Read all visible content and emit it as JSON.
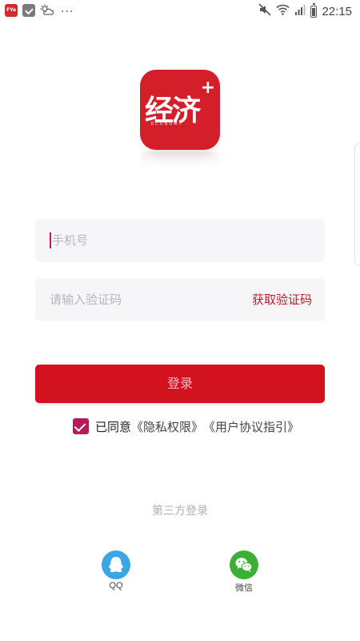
{
  "status_bar": {
    "app_badge": "FYa",
    "more": "...",
    "time": "22:15",
    "icons": [
      "app-notification-icon",
      "check-app-icon",
      "weather-icon",
      "mute-icon",
      "wifi-icon",
      "signal-icon",
      "battery-icon"
    ]
  },
  "logo": {
    "text": "经济",
    "subtext": "ECONOMY",
    "plus": "+",
    "brand_color": "#d41e2a"
  },
  "form": {
    "phone_placeholder": "手机号",
    "code_placeholder": "请输入验证码",
    "get_code_label": "获取验证码",
    "login_label": "登录",
    "login_color": "#d2131f"
  },
  "agreement": {
    "checked": true,
    "prefix": "已同意",
    "privacy_link": "《隐私权限》",
    "terms_link": "《用户协议指引》"
  },
  "third_party": {
    "title": "第三方登录",
    "qq_label": "QQ",
    "wechat_label": "微信"
  }
}
